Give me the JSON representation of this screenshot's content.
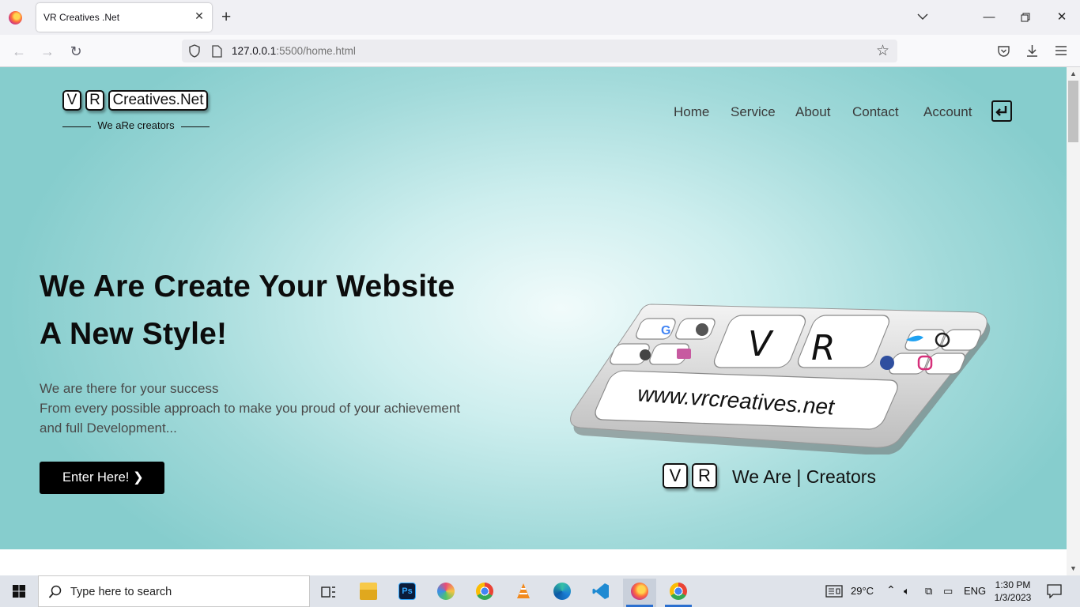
{
  "browser": {
    "tab_title": "VR Creatives .Net",
    "url_host": "127.0.0.1",
    "url_path": ":5500/home.html"
  },
  "site": {
    "logo": {
      "key1": "V",
      "key2": "R",
      "name": "Creatives.Net",
      "tagline": "We aRe creators"
    },
    "nav": [
      "Home",
      "Service",
      "About",
      "Contact",
      "Account"
    ],
    "hero": {
      "heading_line1": "We Are Create Your Website",
      "heading_line2": "A New Style!",
      "para_line1": "We are there for your success",
      "para_line2": "From every possible approach to make you proud of your achievement",
      "para_line3": "and full Development...",
      "cta": "Enter Here! ❯"
    },
    "keyboard": {
      "key_v": "V",
      "key_r": "R",
      "url_key": "www.vrcreatives.net",
      "caption_key1": "V",
      "caption_key2": "R",
      "caption_text": "We Are | Creators"
    },
    "colors": {
      "hero_center": "#f1fbfb",
      "hero_edge": "#86cdcd",
      "button": "#000000"
    }
  },
  "taskbar": {
    "search_placeholder": "Type here to search",
    "weather": "29°C",
    "language": "ENG",
    "time": "1:30 PM",
    "date": "1/3/2023",
    "apps": [
      "task-view-icon",
      "file-explorer-icon",
      "photoshop-icon",
      "paint-icon",
      "chrome-icon",
      "vlc-icon",
      "edge-icon",
      "vscode-icon",
      "firefox-icon",
      "chrome-profile-icon"
    ]
  }
}
